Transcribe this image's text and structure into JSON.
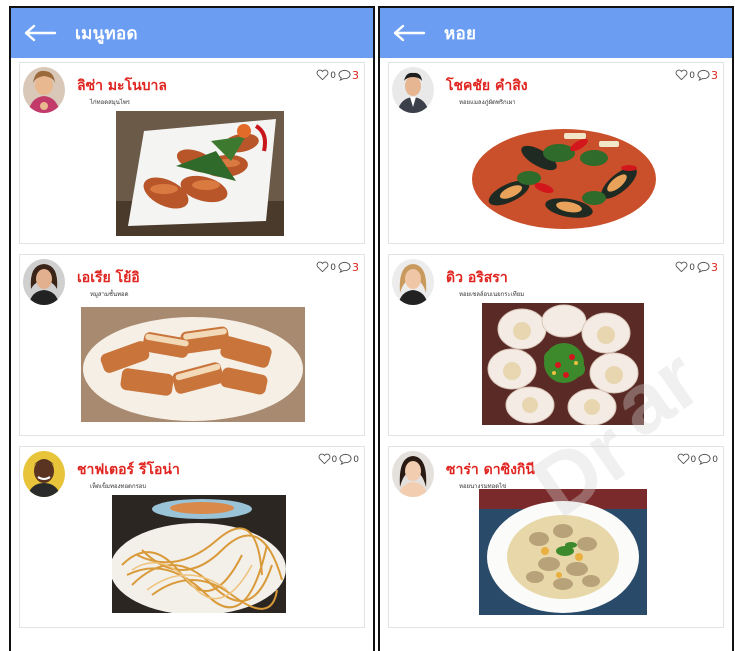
{
  "screens": [
    {
      "title": "เมนูทอด",
      "posts": [
        {
          "author": "ลิซ่า มะโนบาล",
          "description": "ไก่ทอดสมุนไพร",
          "likes": "0",
          "comments": "3",
          "food_icon": "fried-chicken-wings"
        },
        {
          "author": "เอเรีย โย้อิ",
          "description": "หมูสามชั้นทอด",
          "likes": "0",
          "comments": "3",
          "food_icon": "fried-pork-belly"
        },
        {
          "author": "ชาฟเตอร์ รีโอน่า",
          "description": "เห็ดเข็มทองทอดกรอบ",
          "likes": "0",
          "comments": "0",
          "food_icon": "crispy-enoki"
        }
      ]
    },
    {
      "title": "หอย",
      "posts": [
        {
          "author": "โชคชัย คำสิง",
          "description": "หอยแมลงภู่ผัดพริกเผา",
          "likes": "0",
          "comments": "3",
          "food_icon": "mussel-stir-fry"
        },
        {
          "author": "ดิว อริสรา",
          "description": "หอยเชลล์อบเนยกระเทียม",
          "likes": "0",
          "comments": "3",
          "food_icon": "baked-scallops"
        },
        {
          "author": "ซาร่า ดาซิงกินี",
          "description": "หอยนางรมทอดไข่",
          "likes": "0",
          "comments": "0",
          "food_icon": "oyster-omelette"
        }
      ]
    }
  ],
  "colors": {
    "appbar": "#6b9ef2",
    "author_text": "#e0241f",
    "comment_count_nonzero": "#e0241f",
    "card_border": "#e3e3e3"
  },
  "icons": {
    "back": "arrow-left-icon",
    "like": "heart-outline-icon",
    "comment": "speech-bubble-outline-icon"
  }
}
